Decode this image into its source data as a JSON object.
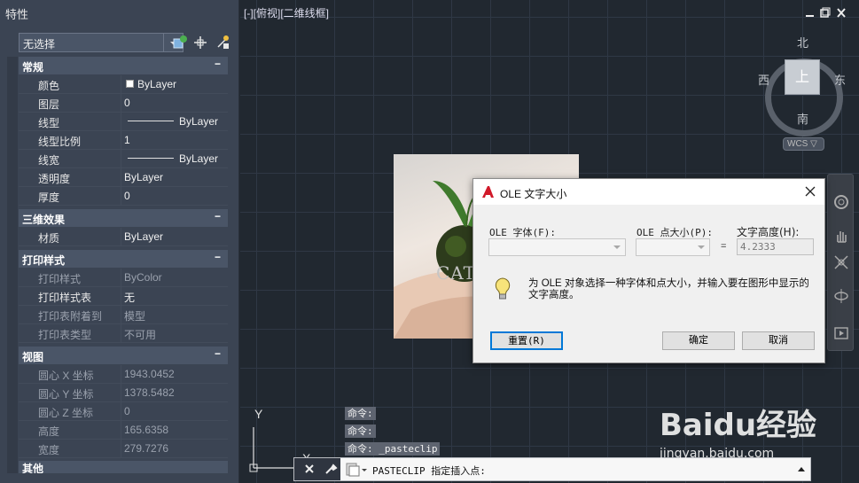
{
  "palette": {
    "title": "特性",
    "selection": "无选择",
    "sections": [
      {
        "title": "常规",
        "rows": [
          {
            "label": "颜色",
            "value": "ByLayer"
          },
          {
            "label": "图层",
            "value": "0"
          },
          {
            "label": "线型",
            "value": "ByLayer"
          },
          {
            "label": "线型比例",
            "value": "1"
          },
          {
            "label": "线宽",
            "value": "ByLayer"
          },
          {
            "label": "透明度",
            "value": "ByLayer"
          },
          {
            "label": "厚度",
            "value": "0"
          }
        ]
      },
      {
        "title": "三维效果",
        "rows": [
          {
            "label": "材质",
            "value": "ByLayer"
          }
        ]
      },
      {
        "title": "打印样式",
        "rows": [
          {
            "label": "打印样式",
            "value": "ByColor"
          },
          {
            "label": "打印样式表",
            "value": "无"
          },
          {
            "label": "打印表附着到",
            "value": "模型"
          },
          {
            "label": "打印表类型",
            "value": "不可用"
          }
        ]
      },
      {
        "title": "视图",
        "rows": [
          {
            "label": "圆心 X 坐标",
            "value": "1943.0452"
          },
          {
            "label": "圆心 Y 坐标",
            "value": "1378.5482"
          },
          {
            "label": "圆心 Z 坐标",
            "value": "0"
          },
          {
            "label": "高度",
            "value": "165.6358"
          },
          {
            "label": "宽度",
            "value": "279.7276"
          }
        ]
      },
      {
        "title": "其他",
        "rows": []
      }
    ],
    "collapse_symbol": "−"
  },
  "viewport": {
    "label": "[-][俯视][二维线框]"
  },
  "viewcube": {
    "north": "北",
    "south": "南",
    "east": "东",
    "west": "西",
    "face": "上",
    "wcs": "WCS ▽"
  },
  "ucs": {
    "y_label": "Y",
    "x_label": "X"
  },
  "image": {
    "overlay_text": "CAT"
  },
  "command_history": [
    "命令:",
    "命令:",
    "命令: _pasteclip"
  ],
  "command_line": {
    "text": "PASTECLIP 指定插入点:"
  },
  "dialog": {
    "title": "OLE 文字大小",
    "font_label": "OLE 字体(F):",
    "size_label": "OLE 点大小(P):",
    "height_label": "文字高度(H):",
    "equals": "=",
    "height_value": "4.2333",
    "hint": "为 OLE 对象选择一种字体和点大小，并输入要在图形中显示的文字高度。",
    "reset_label": "重置(R)",
    "ok_label": "确定",
    "cancel_label": "取消"
  },
  "watermark": {
    "brand": "Baidu经验",
    "url": "jingyan.baidu.com"
  }
}
